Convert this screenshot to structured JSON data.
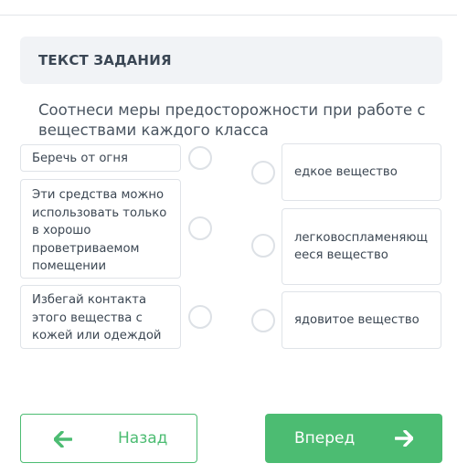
{
  "header": {
    "title": "ТЕКСТ ЗАДАНИЯ"
  },
  "question": "Соотнеси меры предосторожности при работе с веществами каждого класса",
  "left_items": [
    {
      "label": "Беречь от огня"
    },
    {
      "label": "Эти средства можно использовать только в хорошо проветриваемом помещении"
    },
    {
      "label": "Избегай контакта этого вещества с кожей или одеждой"
    }
  ],
  "right_items": [
    {
      "label": "едкое вещество"
    },
    {
      "label": "легковоспламеняющееся вещество"
    },
    {
      "label": "ядовитое вещество"
    }
  ],
  "nav": {
    "back_label": "Назад",
    "next_label": "Вперед"
  },
  "colors": {
    "accent": "#4cbc72",
    "header_bg": "#f1f3f6",
    "border": "#dfe3e8"
  }
}
